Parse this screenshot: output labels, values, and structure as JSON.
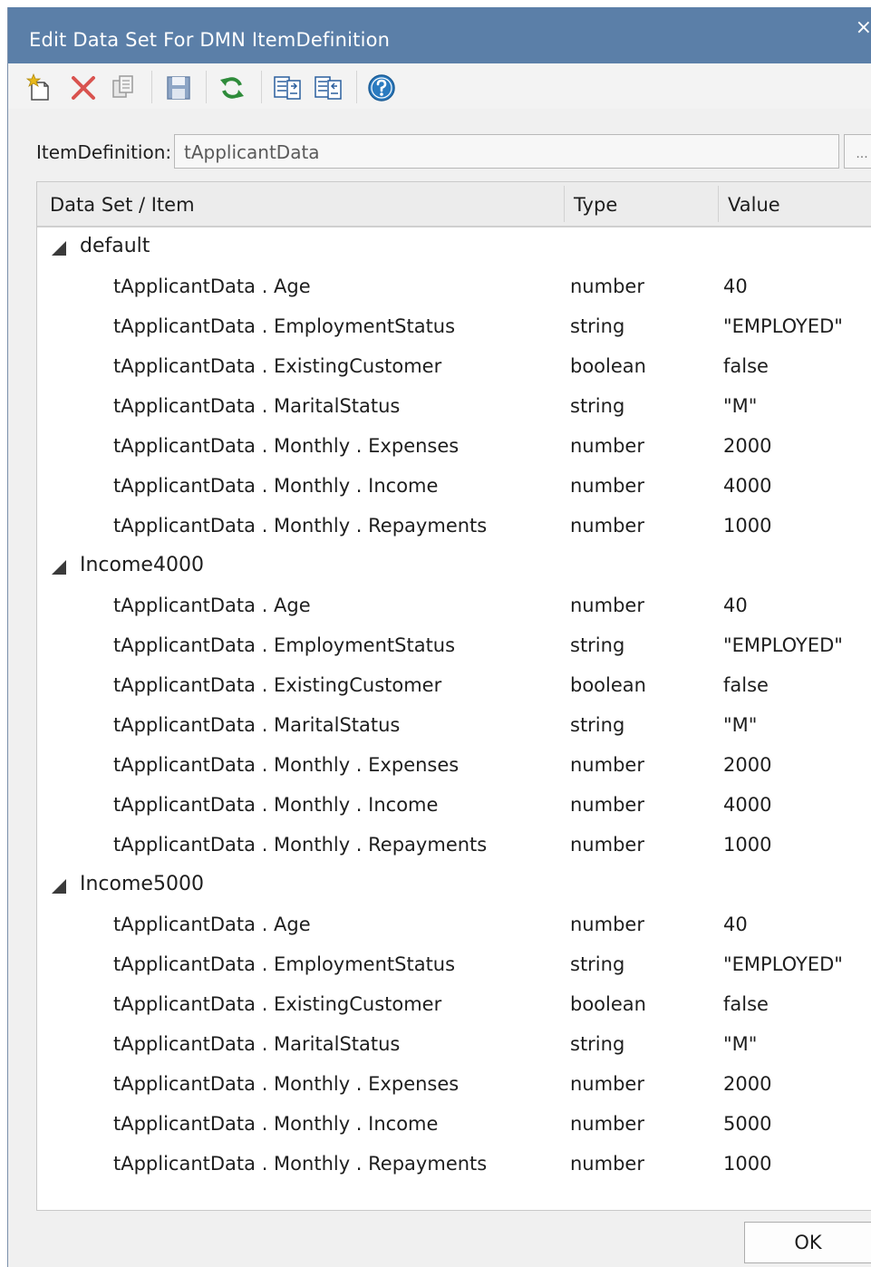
{
  "window": {
    "title": "Edit Data Set For DMN ItemDefinition",
    "close_glyph": "×"
  },
  "toolbar": {
    "buttons": [
      {
        "icon": "new-dataset-icon",
        "color": "#d4a017"
      },
      {
        "icon": "delete-icon",
        "color": "#d9534f"
      },
      {
        "icon": "copy-icon",
        "color": "#9a9a9a"
      },
      {
        "icon": "save-icon",
        "color": "#7d97b8"
      },
      {
        "icon": "refresh-icon",
        "color": "#2e8b3a"
      },
      {
        "icon": "import-icon",
        "color": "#2b5f9e"
      },
      {
        "icon": "export-icon",
        "color": "#2b5f9e"
      },
      {
        "icon": "help-icon",
        "color": "#2b7bc0"
      }
    ]
  },
  "item_definition": {
    "label": "ItemDefinition:",
    "value": "tApplicantData",
    "browse_label": "..."
  },
  "grid": {
    "columns": [
      "Data Set / Item",
      "Type",
      "Value"
    ],
    "groups": [
      {
        "name": "default",
        "rows": [
          {
            "item": "tApplicantData . Age",
            "type": "number",
            "value": "40"
          },
          {
            "item": "tApplicantData . EmploymentStatus",
            "type": "string",
            "value": "\"EMPLOYED\""
          },
          {
            "item": "tApplicantData . ExistingCustomer",
            "type": "boolean",
            "value": "false"
          },
          {
            "item": "tApplicantData . MaritalStatus",
            "type": "string",
            "value": "\"M\""
          },
          {
            "item": "tApplicantData . Monthly . Expenses",
            "type": "number",
            "value": "2000"
          },
          {
            "item": "tApplicantData . Monthly . Income",
            "type": "number",
            "value": "4000"
          },
          {
            "item": "tApplicantData . Monthly . Repayments",
            "type": "number",
            "value": "1000"
          }
        ]
      },
      {
        "name": "Income4000",
        "rows": [
          {
            "item": "tApplicantData . Age",
            "type": "number",
            "value": "40"
          },
          {
            "item": "tApplicantData . EmploymentStatus",
            "type": "string",
            "value": "\"EMPLOYED\""
          },
          {
            "item": "tApplicantData . ExistingCustomer",
            "type": "boolean",
            "value": "false"
          },
          {
            "item": "tApplicantData . MaritalStatus",
            "type": "string",
            "value": "\"M\""
          },
          {
            "item": "tApplicantData . Monthly . Expenses",
            "type": "number",
            "value": "2000"
          },
          {
            "item": "tApplicantData . Monthly . Income",
            "type": "number",
            "value": "4000"
          },
          {
            "item": "tApplicantData . Monthly . Repayments",
            "type": "number",
            "value": "1000"
          }
        ]
      },
      {
        "name": "Income5000",
        "rows": [
          {
            "item": "tApplicantData . Age",
            "type": "number",
            "value": "40"
          },
          {
            "item": "tApplicantData . EmploymentStatus",
            "type": "string",
            "value": "\"EMPLOYED\""
          },
          {
            "item": "tApplicantData . ExistingCustomer",
            "type": "boolean",
            "value": "false"
          },
          {
            "item": "tApplicantData . MaritalStatus",
            "type": "string",
            "value": "\"M\""
          },
          {
            "item": "tApplicantData . Monthly . Expenses",
            "type": "number",
            "value": "2000"
          },
          {
            "item": "tApplicantData . Monthly . Income",
            "type": "number",
            "value": "5000"
          },
          {
            "item": "tApplicantData . Monthly . Repayments",
            "type": "number",
            "value": "1000"
          }
        ]
      }
    ]
  },
  "footer": {
    "ok_label": "OK"
  },
  "colors": {
    "titlebar": "#5b7fa8",
    "dialog_bg": "#f0f0f0"
  }
}
